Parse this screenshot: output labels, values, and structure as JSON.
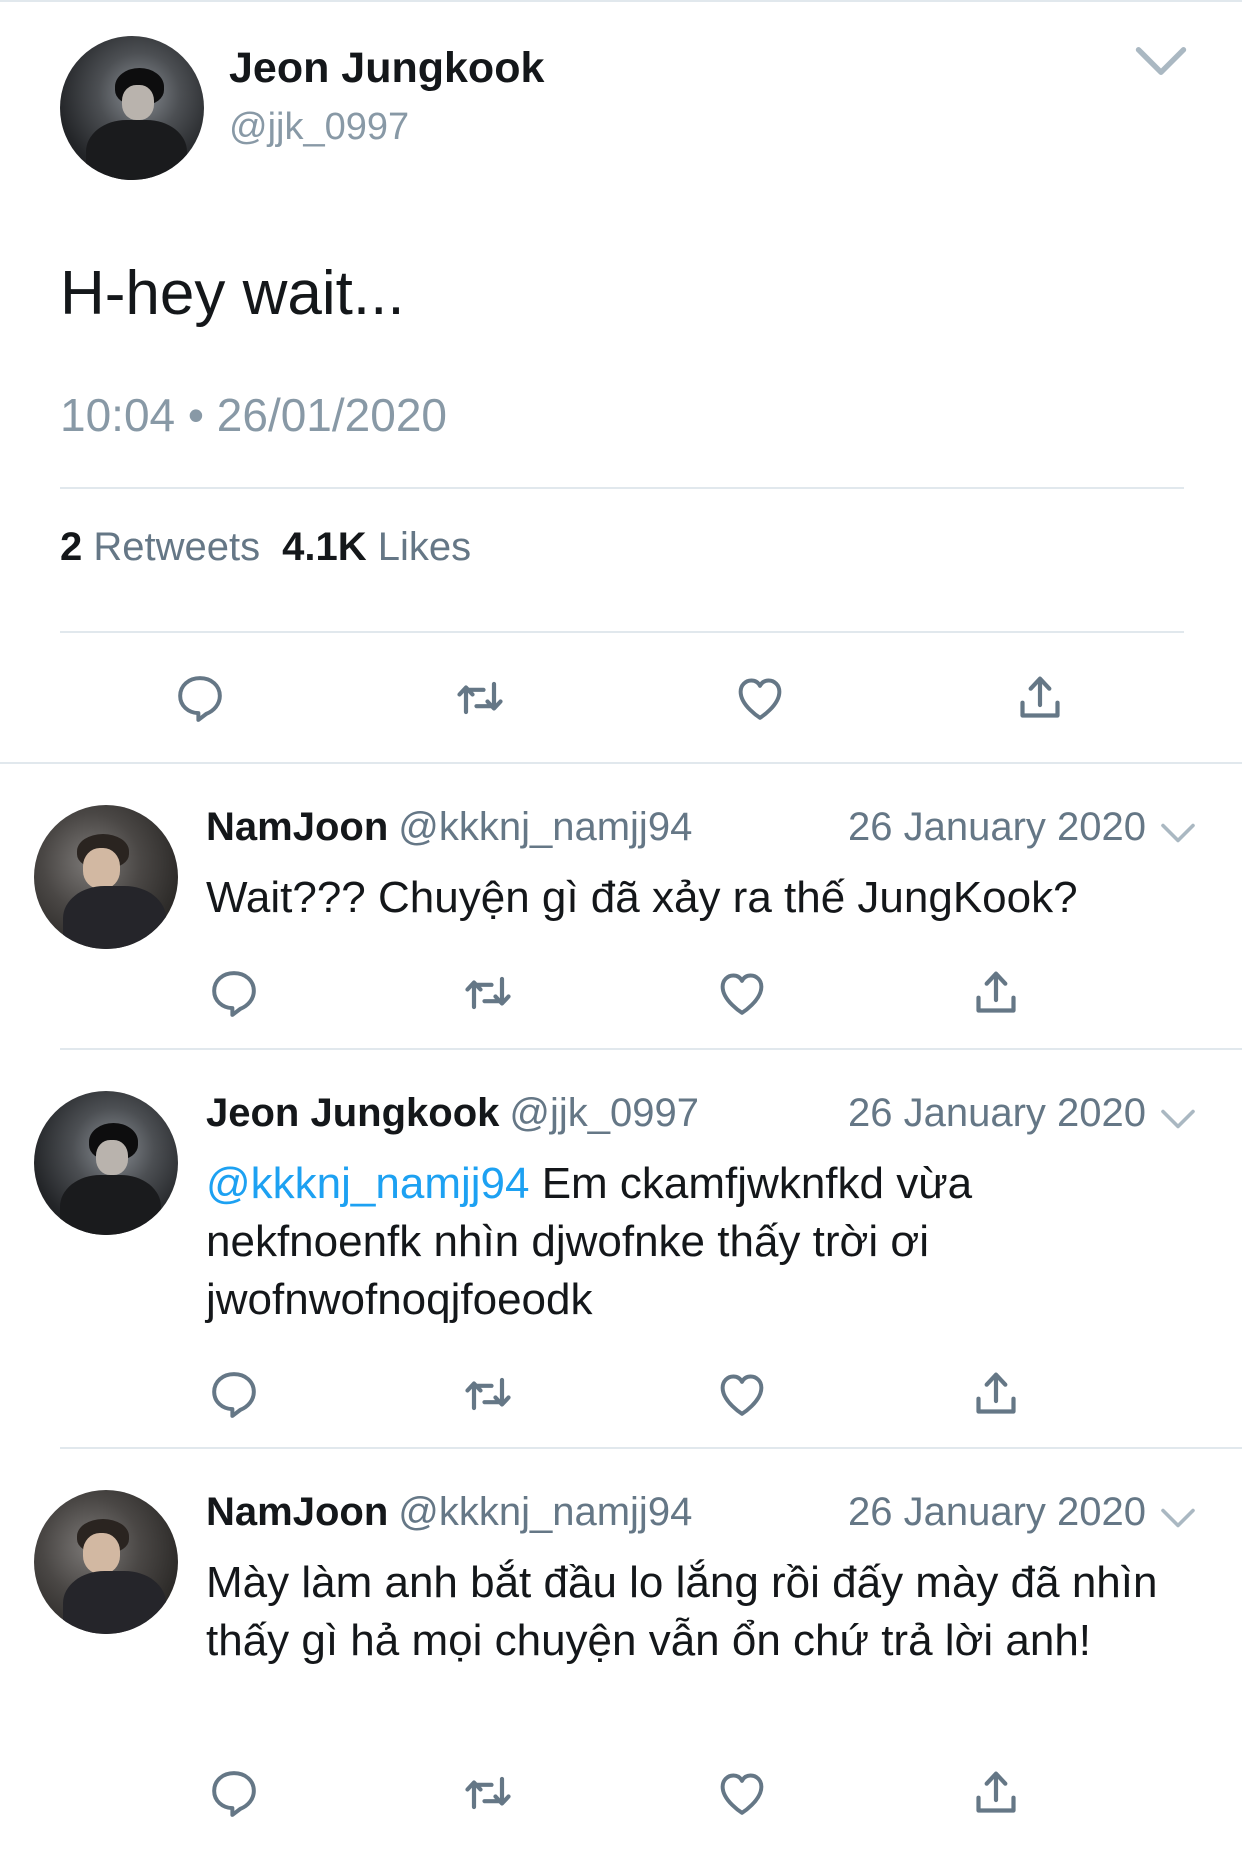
{
  "main_tweet": {
    "author_name": "Jeon Jungkook",
    "author_handle": "@jjk_0997",
    "text": "H-hey wait...",
    "timestamp": "10:04 • 26/01/2020",
    "retweets_count": "2",
    "retweets_label": "Retweets",
    "likes_count": "4.1K",
    "likes_label": "Likes"
  },
  "icons": {
    "reply": "reply-icon",
    "retweet": "retweet-icon",
    "like": "heart-icon",
    "share": "share-icon",
    "menu": "chevron-down-icon"
  },
  "colors": {
    "accent": "#1da1f2",
    "icon_gray": "#657786",
    "secondary_text": "#8899a6"
  },
  "replies": [
    {
      "author_name": "NamJoon",
      "author_handle": "@kkknj_namjj94",
      "date": "26 January 2020",
      "mention": "",
      "text": "Wait??? Chuyện gì đã xảy ra thế JungKook?"
    },
    {
      "author_name": "Jeon Jungkook",
      "author_handle": "@jjk_0997",
      "date": "26 January 2020",
      "mention": "@kkknj_namjj94",
      "text": "Em ckamfjwknfkd vừa nekfnoenfk nhìn djwofnke thấy trời ơi jwofnwofnoqjfoeodk"
    },
    {
      "author_name": "NamJoon",
      "author_handle": "@kkknj_namjj94",
      "date": "26 January 2020",
      "mention": "",
      "text": "Mày làm anh bắt đầu lo lắng rồi đấy mày đã nhìn thấy gì hả mọi chuyện vẫn ổn chứ trả lời anh!"
    }
  ]
}
